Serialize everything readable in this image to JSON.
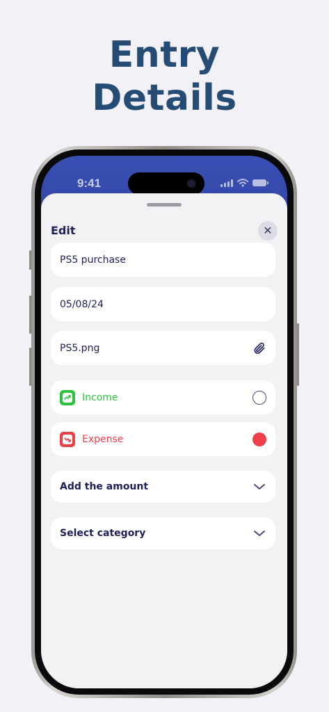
{
  "headline": {
    "line1": "Entry",
    "line2": "Details"
  },
  "status_bar": {
    "time": "9:41"
  },
  "sheet": {
    "title": "Edit",
    "close_glyph": "✕"
  },
  "form": {
    "name": "PS5 purchase",
    "date": "05/08/24",
    "attachment": "PS5.png",
    "type_options": [
      {
        "label": "Income",
        "selected": false,
        "color": "#2cc13f"
      },
      {
        "label": "Expense",
        "selected": true,
        "color": "#ee3f48"
      }
    ],
    "amount_label": "Add the amount",
    "category_label": "Select category"
  },
  "colors": {
    "headline": "#244c74",
    "text": "#1e1e5a",
    "accent_top": "#3a4fb3",
    "background": "#f1f1f7"
  },
  "icons": {
    "close": "close-icon",
    "attachment": "paperclip-icon",
    "income": "trend-up-icon",
    "expense": "trend-down-icon",
    "dropdown": "chevron-down-icon"
  }
}
